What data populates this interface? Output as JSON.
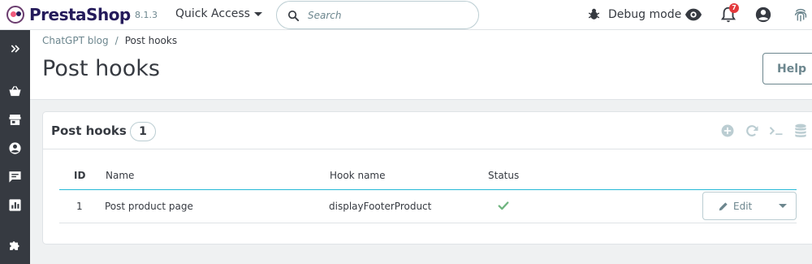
{
  "header": {
    "brand": "PrestaShop",
    "version": "8.1.3",
    "quick_access_label": "Quick Access",
    "search_placeholder": "Search",
    "debug_label": "Debug mode",
    "notification_count": "7"
  },
  "sidebar": {
    "items": [
      {
        "icon": "expand-double-chevron-icon"
      },
      {
        "icon": "shopping-basket-icon"
      },
      {
        "icon": "store-icon"
      },
      {
        "icon": "account-circle-icon"
      },
      {
        "icon": "chat-bubble-icon"
      },
      {
        "icon": "bar-chart-icon"
      },
      {
        "icon": "puzzle-piece-icon"
      }
    ]
  },
  "breadcrumb": {
    "parent": "ChatGPT blog",
    "separator": "/",
    "current": "Post hooks"
  },
  "page": {
    "title": "Post hooks",
    "help_label": "Help"
  },
  "panel": {
    "title": "Post hooks",
    "count": "1",
    "table": {
      "columns": [
        "ID",
        "Name",
        "Hook name",
        "Status"
      ],
      "rows": [
        {
          "id": "1",
          "name": "Post product page",
          "hook_name": "displayFooterProduct",
          "status": "enabled",
          "action_label": "Edit"
        }
      ]
    }
  },
  "colors": {
    "accent": "#25b9d7",
    "sidebar": "#363a41",
    "status_ok": "#70b580",
    "badge": "#e4393c"
  }
}
